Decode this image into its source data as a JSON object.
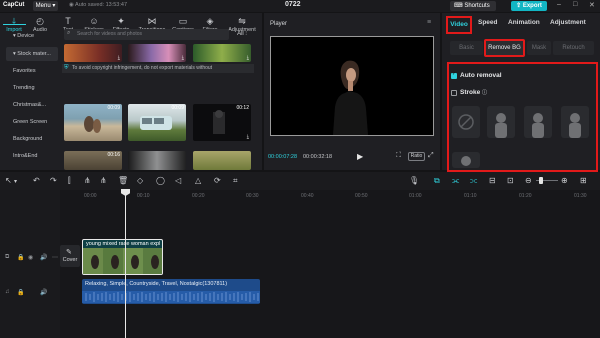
{
  "titlebar": {
    "app_name": "CapCut",
    "menu_label": "Menu",
    "autosave": "Auto saved: 13:53:47",
    "project_name": "0722",
    "shortcuts_label": "Shortcuts",
    "export_label": "Export"
  },
  "media_tabs": [
    {
      "label": "Import",
      "icon": "import-icon",
      "glyph": "⤓",
      "active": true
    },
    {
      "label": "Audio",
      "icon": "audio-icon",
      "glyph": "◴"
    },
    {
      "label": "Text",
      "icon": "text-icon",
      "glyph": "T"
    },
    {
      "label": "Stickers",
      "icon": "stickers-icon",
      "glyph": "☺"
    },
    {
      "label": "Effects",
      "icon": "effects-icon",
      "glyph": "✦"
    },
    {
      "label": "Transitions",
      "icon": "transitions-icon",
      "glyph": "⋈"
    },
    {
      "label": "Captions",
      "icon": "captions-icon",
      "glyph": "▭"
    },
    {
      "label": "Filters",
      "icon": "filters-icon",
      "glyph": "◈"
    },
    {
      "label": "Adjustment",
      "icon": "adjustment-icon",
      "glyph": "⇋"
    }
  ],
  "sidenav": [
    {
      "label": "▾ Device"
    },
    {
      "label": "▾ Stock mater...",
      "active": true
    },
    {
      "label": "Favorites"
    },
    {
      "label": "Trending"
    },
    {
      "label": "Christmas&..."
    },
    {
      "label": "Green Screen"
    },
    {
      "label": "Background"
    },
    {
      "label": "Intro&End"
    }
  ],
  "search": {
    "placeholder": "Search for videos and photos",
    "filter_label": "All"
  },
  "notice": "To avoid copyright infringement, do not export materials without",
  "thumbnails": [
    {
      "duration": ""
    },
    {
      "duration": ""
    },
    {
      "duration": ""
    },
    {
      "duration": "00:09"
    },
    {
      "duration": "00:09"
    },
    {
      "duration": "00:12"
    },
    {
      "duration": "00:16"
    },
    {
      "duration": ""
    },
    {
      "duration": ""
    }
  ],
  "player": {
    "title": "Player",
    "current_time": "00:00:07:28",
    "total_time": "00:00:32:18",
    "ratio_label": "Ratio"
  },
  "props": {
    "tabs": [
      "Video",
      "Speed",
      "Animation",
      "Adjustment"
    ],
    "subtabs": [
      "Basic",
      "Remove BG",
      "Mask",
      "Retouch"
    ],
    "auto_removal": "Auto removal",
    "stroke": "Stroke"
  },
  "timeline": {
    "ruler": [
      "00:00",
      "00:10",
      "00:20",
      "00:30",
      "00:40",
      "00:50",
      "01:00",
      "01:10",
      "01:20",
      "01:30",
      "01:40"
    ],
    "cover_label": "Cover",
    "video_clip": "young mixed race woman expl",
    "audio_clip": "Relaxing, Simple, Countryside, Travel, Nostalgic(1307811)"
  },
  "colors": {
    "accent": "#2fd3df",
    "highlight": "#e21a1a",
    "audio_clip": "#1e4b8a",
    "video_clip": "#0e3f44"
  }
}
